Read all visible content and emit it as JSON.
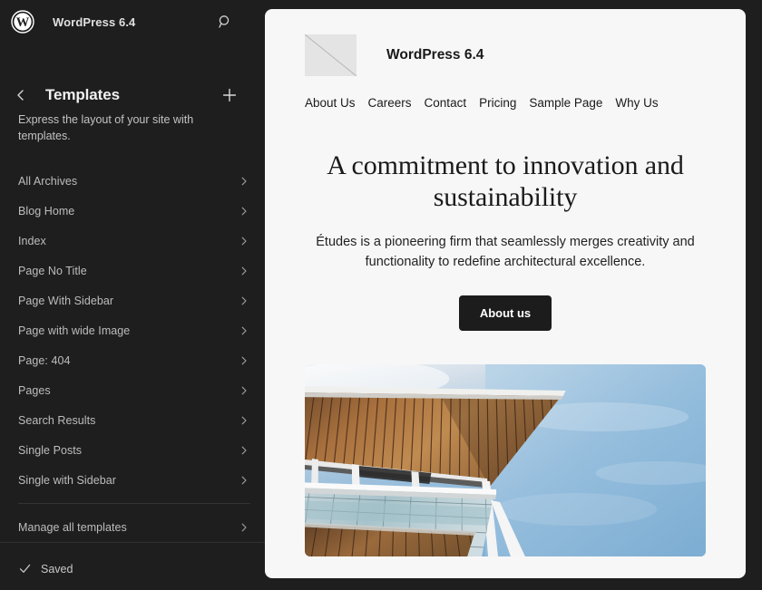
{
  "sidebar": {
    "logo_icon": "wordpress-logo-icon",
    "site_title": "WordPress 6.4",
    "search_icon": "search-icon",
    "back_icon": "chevron-left-icon",
    "panel_title": "Templates",
    "add_icon": "plus-icon",
    "description": "Express the layout of your site with templates.",
    "items": [
      {
        "label": "All Archives"
      },
      {
        "label": "Blog Home"
      },
      {
        "label": "Index"
      },
      {
        "label": "Page No Title"
      },
      {
        "label": "Page With Sidebar"
      },
      {
        "label": "Page with wide Image"
      },
      {
        "label": "Page: 404"
      },
      {
        "label": "Pages"
      },
      {
        "label": "Search Results"
      },
      {
        "label": "Single Posts"
      },
      {
        "label": "Single with Sidebar"
      }
    ],
    "manage_item": {
      "label": "Manage all templates"
    },
    "footer": {
      "check_icon": "checkmark-icon",
      "status": "Saved"
    }
  },
  "preview": {
    "logo_placeholder_icon": "image-placeholder-icon",
    "brand_name": "WordPress 6.4",
    "nav": [
      {
        "label": "About Us"
      },
      {
        "label": "Careers"
      },
      {
        "label": "Contact"
      },
      {
        "label": "Pricing"
      },
      {
        "label": "Sample Page"
      },
      {
        "label": "Why Us"
      }
    ],
    "heading": "A commitment to innovation and sustainability",
    "lead": "Études is a pioneering firm that seamlessly merges creativity and functionality to redefine architectural excellence.",
    "cta_label": "About us",
    "figure_alt": "architecture-photo"
  },
  "colors": {
    "app_background": "#1e1e1e",
    "sidebar_text": "#bdbdbd",
    "sidebar_title": "#f0f0f0",
    "canvas_background": "#f7f7f7",
    "button_background": "#1c1c1c",
    "button_text": "#ffffff",
    "divider": "#333333"
  }
}
